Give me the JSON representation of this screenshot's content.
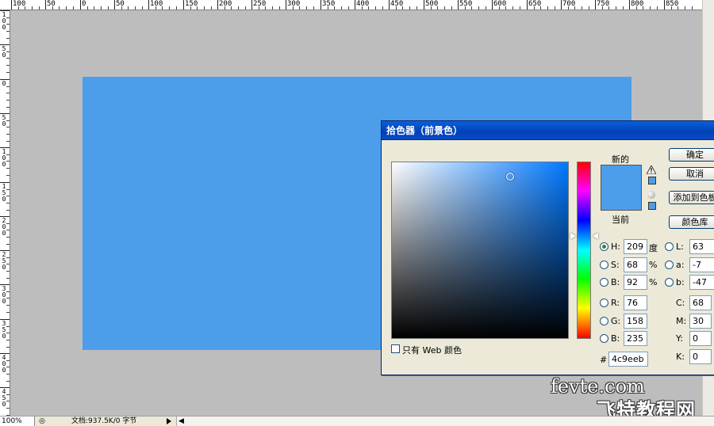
{
  "rulers": {
    "top_labels": [
      "100",
      "50",
      "0",
      "50",
      "100",
      "150",
      "200",
      "250",
      "300",
      "350",
      "400",
      "450",
      "500",
      "550",
      "600",
      "650",
      "700",
      "750",
      "800",
      "850"
    ],
    "left_labels": [
      "100",
      "50",
      "0",
      "50",
      "100",
      "150",
      "200",
      "250",
      "300",
      "350",
      "400",
      "450"
    ]
  },
  "canvas": {
    "fill_color": "#4c9eeb",
    "pasteboard_color": "#bdbdbd"
  },
  "dialog": {
    "title": "拾色器（前景色）",
    "new_label": "新的",
    "current_label": "当前",
    "buttons": {
      "ok": "确定",
      "cancel": "取消",
      "add_swatch": "添加到色板",
      "libraries": "颜色库"
    },
    "hsb": {
      "h": {
        "label": "H:",
        "value": "209",
        "unit": "度",
        "selected": true
      },
      "s": {
        "label": "S:",
        "value": "68",
        "unit": "%"
      },
      "b": {
        "label": "B:",
        "value": "92",
        "unit": "%"
      }
    },
    "rgb": {
      "r": {
        "label": "R:",
        "value": "76"
      },
      "g": {
        "label": "G:",
        "value": "158"
      },
      "b": {
        "label": "B:",
        "value": "235"
      }
    },
    "lab": {
      "l": {
        "label": "L:",
        "value": "63"
      },
      "a": {
        "label": "a:",
        "value": "-7"
      },
      "b": {
        "label": "b:",
        "value": "-47"
      }
    },
    "cmyk": {
      "c": {
        "label": "C:",
        "value": "68"
      },
      "m": {
        "label": "M:",
        "value": "30"
      },
      "y": {
        "label": "Y:",
        "value": "0"
      },
      "k": {
        "label": "K:",
        "value": "0"
      }
    },
    "hex": {
      "label": "#",
      "value": "4c9eeb"
    },
    "web_only": {
      "label": "只有 Web 颜色",
      "checked": false
    },
    "colors": {
      "new": "#4c9eeb",
      "current": "#4c9eeb"
    }
  },
  "status": {
    "zoom": "100%",
    "doc_info": "文档:937.5K/0 字节"
  },
  "watermark": {
    "line1": "fevte.com",
    "line2": "飞特教程网"
  }
}
